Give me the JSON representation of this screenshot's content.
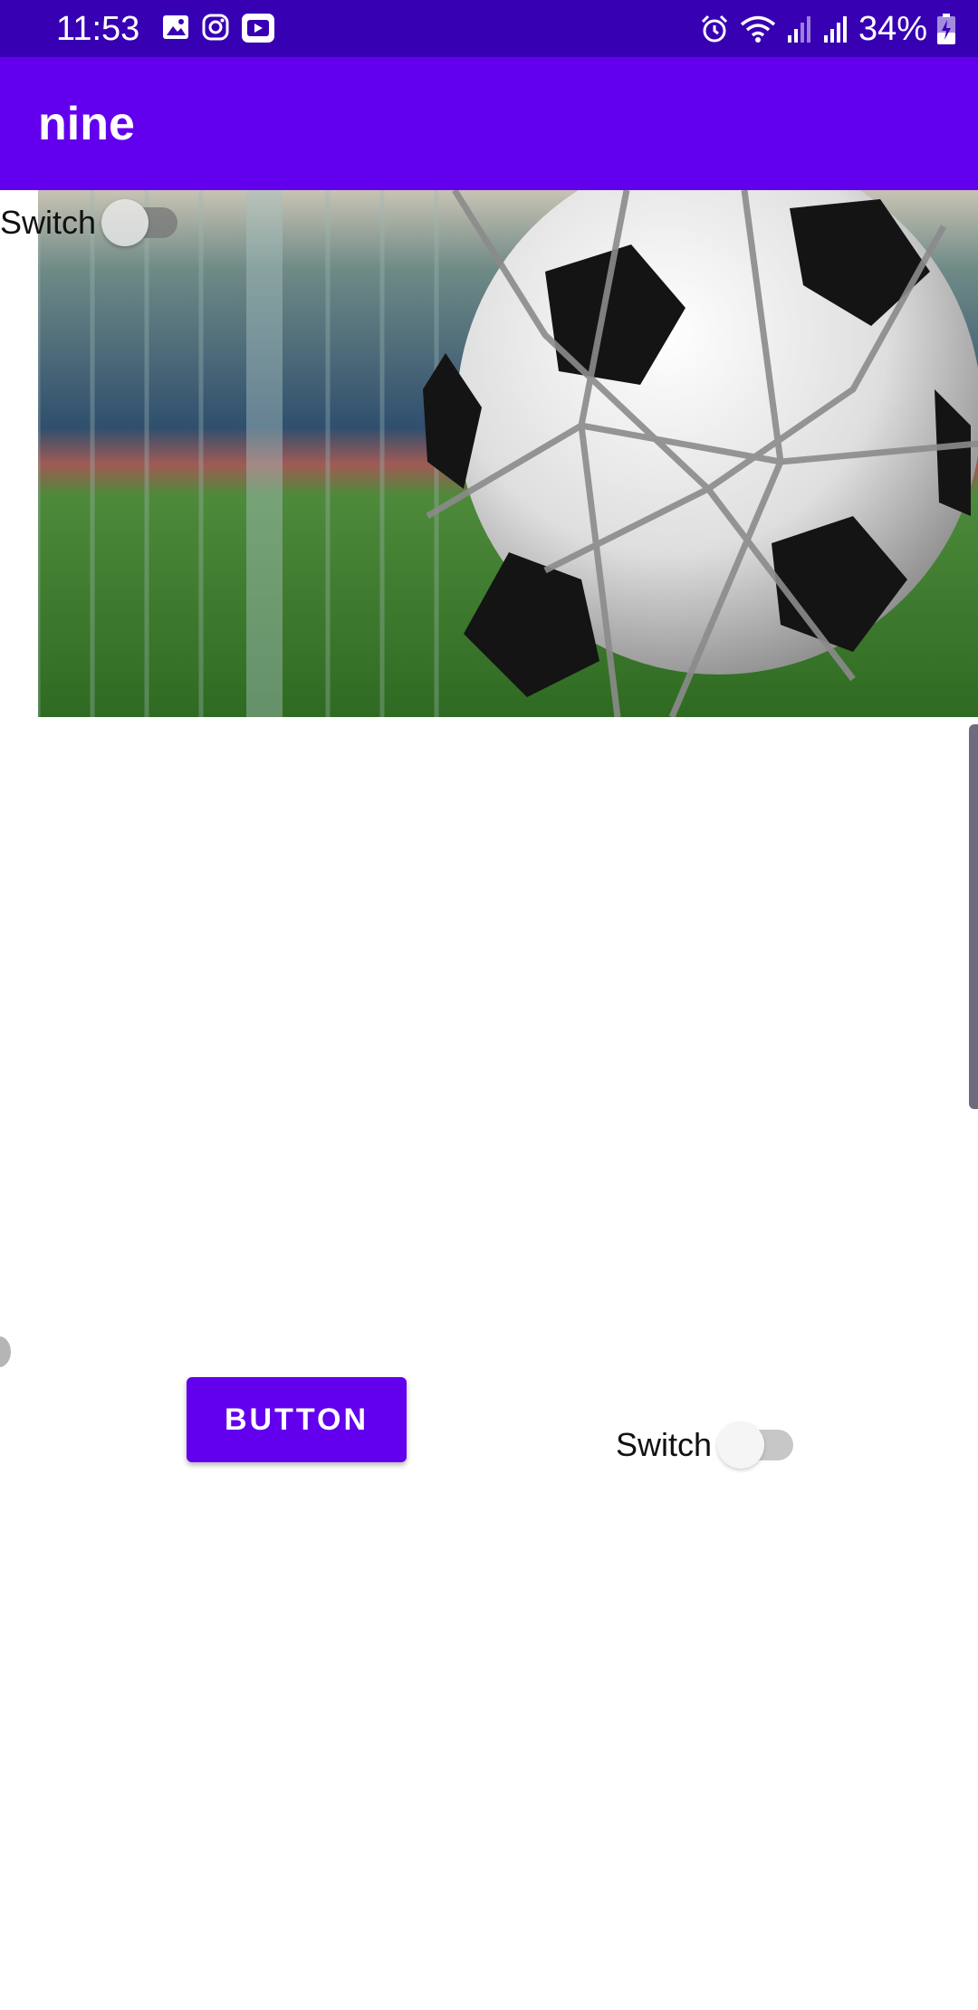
{
  "status_bar": {
    "time": "11:53",
    "battery": "34%",
    "icons_left": [
      "gallery-icon",
      "instagram-icon",
      "video-app-icon"
    ],
    "icons_right": [
      "alarm-icon",
      "wifi-icon",
      "signal-icon",
      "signal-icon",
      "battery-charging-icon"
    ]
  },
  "app_bar": {
    "title": "nine"
  },
  "image": {
    "subject": "soccer-ball-in-net"
  },
  "switch_top": {
    "label": "Switch",
    "checked": false
  },
  "button": {
    "label": "BUTTON"
  },
  "switch_bottom": {
    "label": "Switch",
    "checked": false
  },
  "colors": {
    "status_bar": "#3700b3",
    "primary": "#6200ee",
    "background": "#ffffff"
  }
}
